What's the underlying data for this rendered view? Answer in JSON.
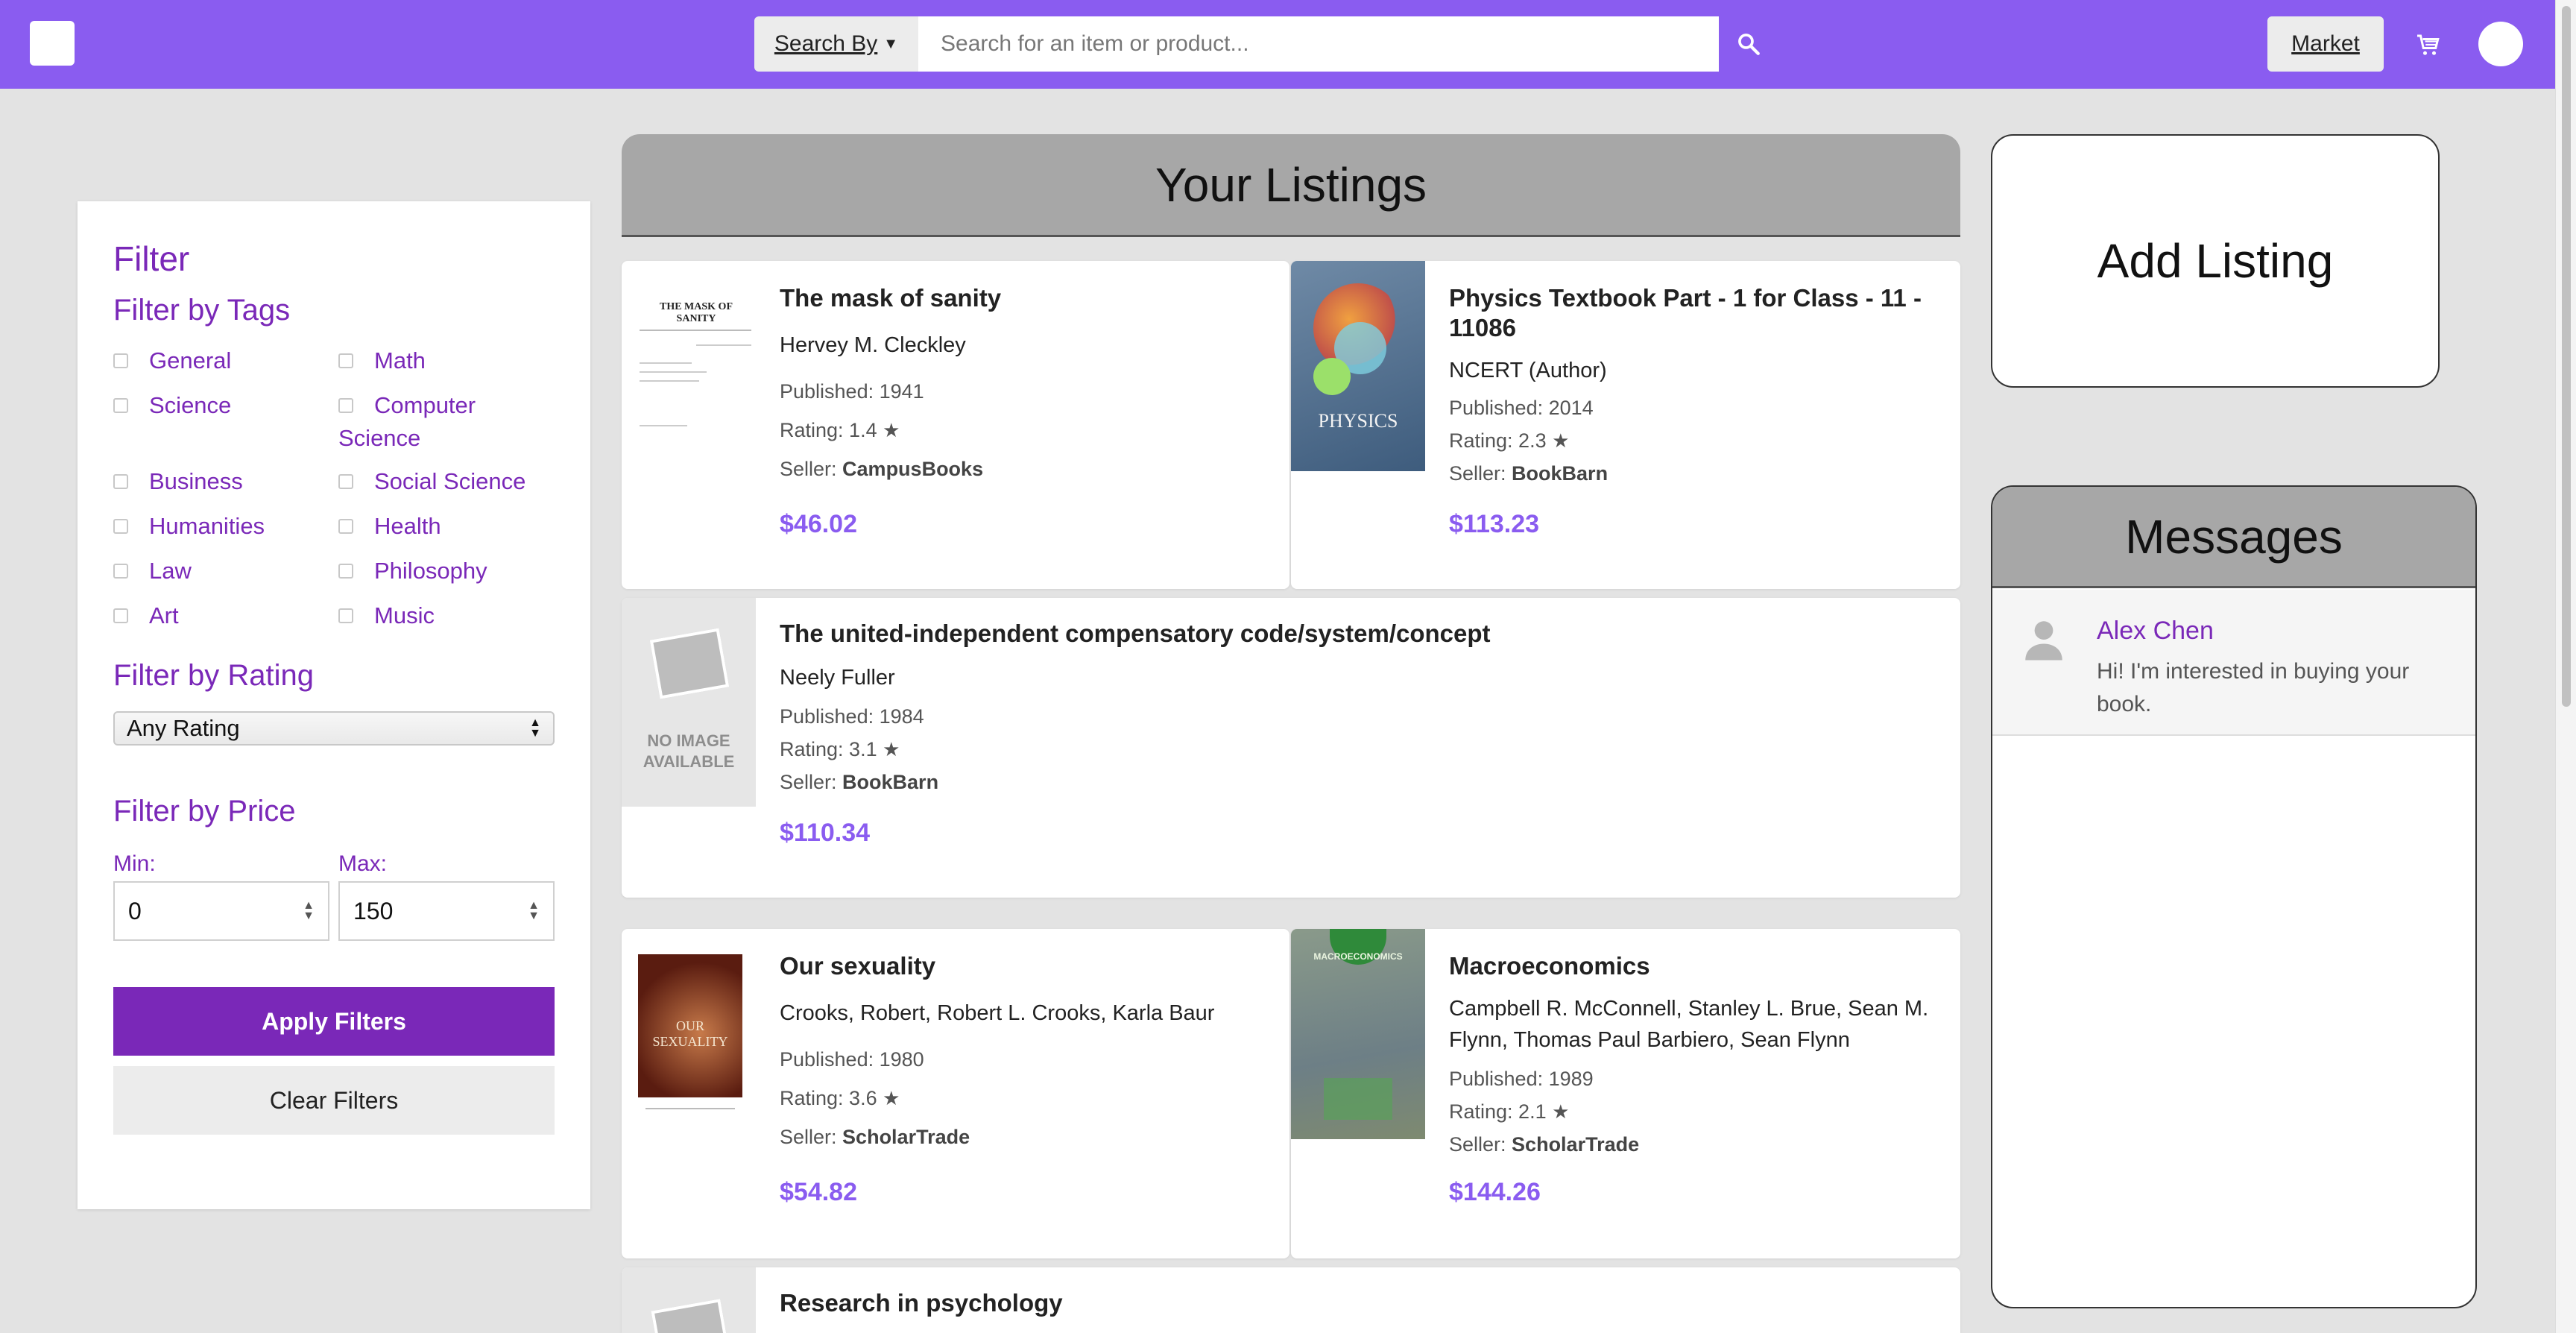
{
  "header": {
    "search_by_label": "Search By",
    "search_placeholder": "Search for an item or product...",
    "market_label": "Market"
  },
  "filter": {
    "title": "Filter",
    "tags_title": "Filter by Tags",
    "tags": [
      {
        "label": "General"
      },
      {
        "label": "Math"
      },
      {
        "label": "Science"
      },
      {
        "label": "Computer Science"
      },
      {
        "label": "Business"
      },
      {
        "label": "Social Science"
      },
      {
        "label": "Humanities"
      },
      {
        "label": "Health"
      },
      {
        "label": "Law"
      },
      {
        "label": "Philosophy"
      },
      {
        "label": "Art"
      },
      {
        "label": "Music"
      }
    ],
    "rating_title": "Filter by Rating",
    "rating_selected": "Any Rating",
    "price_title": "Filter by Price",
    "min_label": "Min:",
    "max_label": "Max:",
    "min_value": "0",
    "max_value": "150",
    "apply_label": "Apply Filters",
    "clear_label": "Clear Filters"
  },
  "listings": {
    "title": "Your Listings",
    "items": [
      {
        "title": "The mask of sanity",
        "author": "Hervey M. Cleckley",
        "published": "Published: 1941",
        "rating": "Rating: 1.4",
        "seller_prefix": "Seller:",
        "seller": "CampusBooks",
        "price": "$46.02",
        "cover": "THE MASK OF SANITY"
      },
      {
        "title": "Physics Textbook Part - 1 for Class - 11 - 11086",
        "author": "NCERT (Author)",
        "published": "Published: 2014",
        "rating": "Rating: 2.3",
        "seller_prefix": "Seller:",
        "seller": "BookBarn",
        "price": "$113.23",
        "cover": "PHYSICS"
      },
      {
        "title": "The united-independent compensatory code/system/concept",
        "author": "Neely Fuller",
        "published": "Published: 1984",
        "rating": "Rating: 3.1",
        "seller_prefix": "Seller:",
        "seller": "BookBarn",
        "price": "$110.34",
        "cover": "NO IMAGE AVAILABLE"
      },
      {
        "title": "Our sexuality",
        "author": "Crooks, Robert, Robert L. Crooks, Karla Baur",
        "published": "Published: 1980",
        "rating": "Rating: 3.6",
        "seller_prefix": "Seller:",
        "seller": "ScholarTrade",
        "price": "$54.82",
        "cover": "OUR SEXUALITY"
      },
      {
        "title": "Macroeconomics",
        "author": "Campbell R. McConnell, Stanley L. Brue, Sean M. Flynn, Thomas Paul Barbiero, Sean Flynn",
        "published": "Published: 1989",
        "rating": "Rating: 2.1",
        "seller_prefix": "Seller:",
        "seller": "ScholarTrade",
        "price": "$144.26",
        "cover": "MACROECONOMICS"
      },
      {
        "title": "Research in psychology"
      }
    ]
  },
  "add_listing_label": "Add Listing",
  "messages": {
    "title": "Messages",
    "items": [
      {
        "name": "Alex Chen",
        "text": "Hi! I'm interested in buying your book."
      }
    ]
  },
  "colors": {
    "brand": "#8a5cf0",
    "accent": "#7a28b8",
    "price": "#8a5cf0"
  }
}
